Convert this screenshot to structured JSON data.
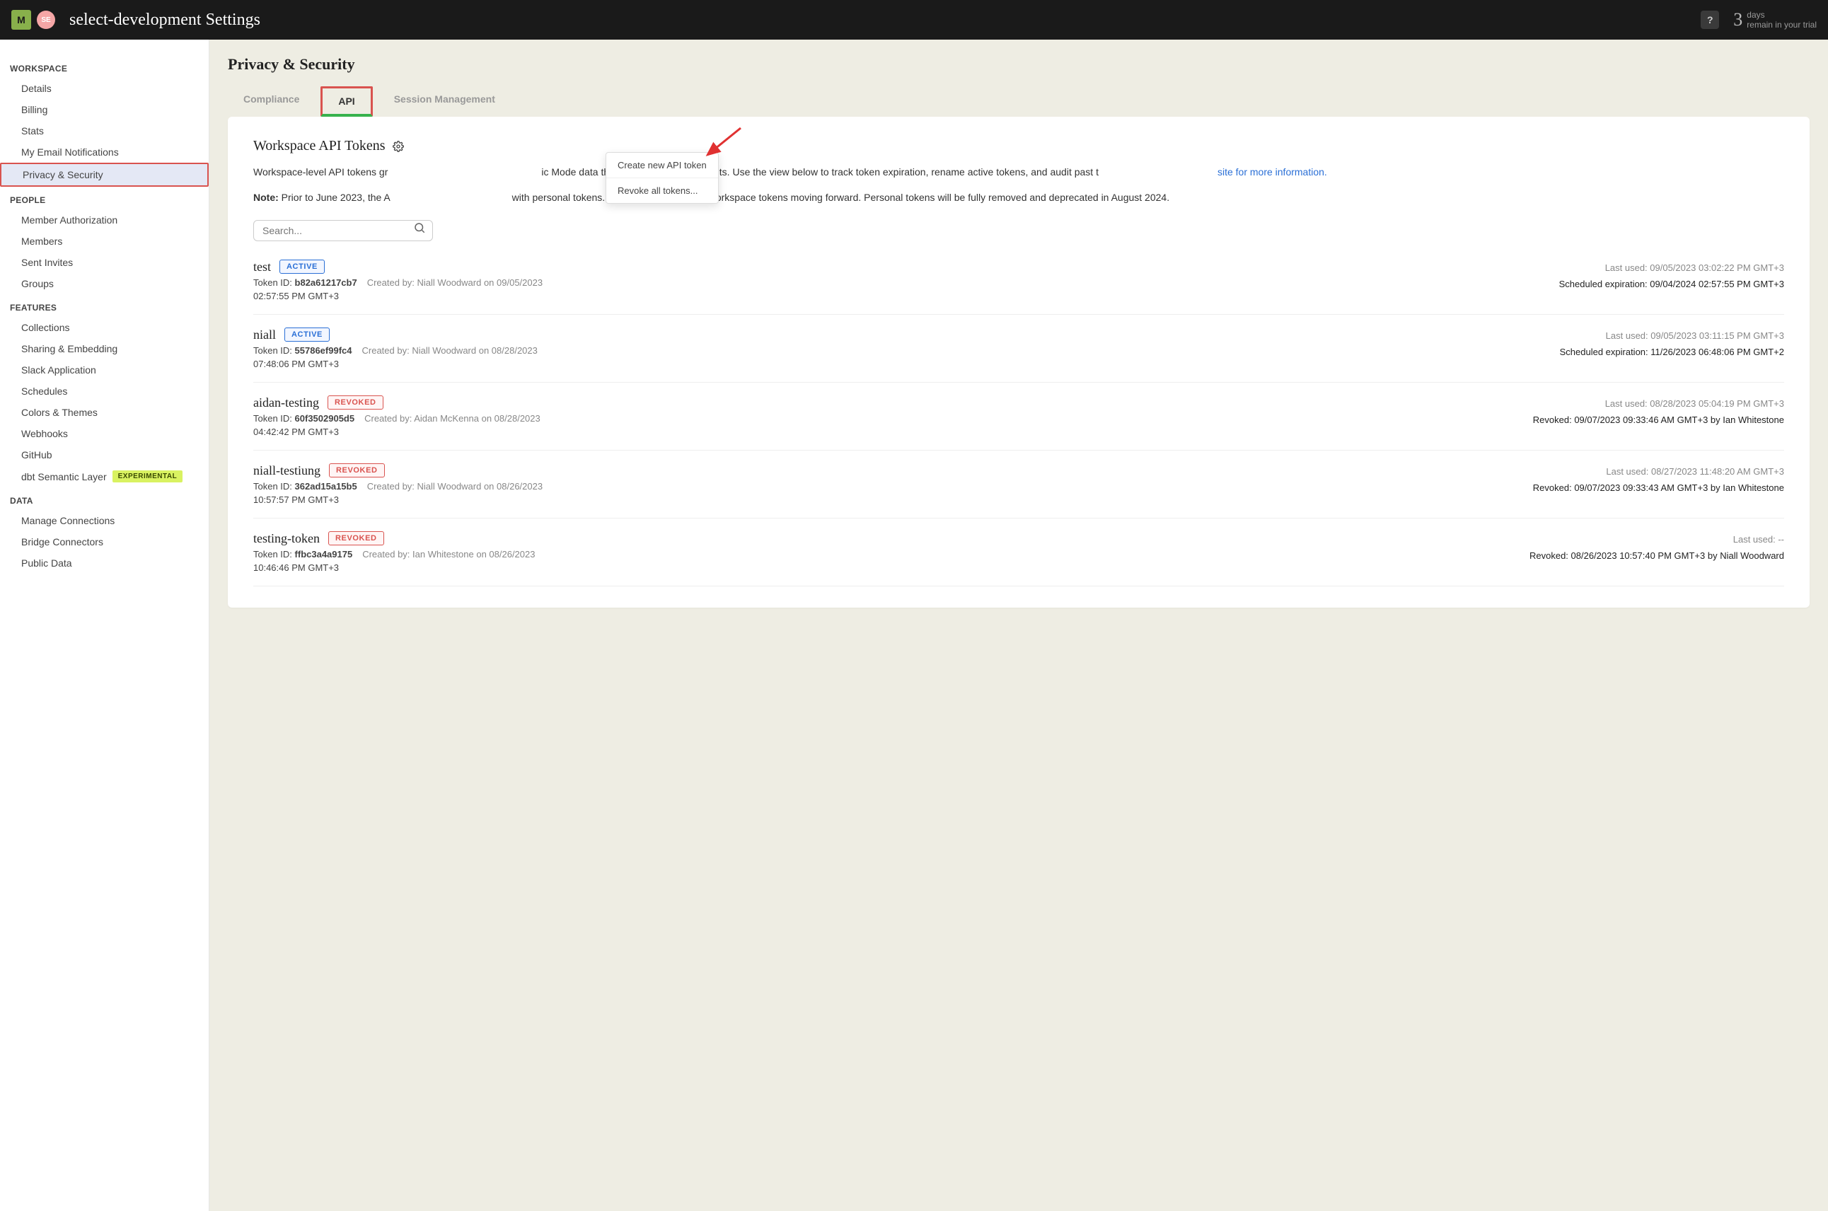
{
  "topbar": {
    "logo_text": "M",
    "avatar_text": "SE",
    "title": "select-development Settings",
    "help_icon": "?",
    "trial_num": "3",
    "trial_line1": "days",
    "trial_line2": "remain in your trial"
  },
  "sidebar": {
    "sections": [
      {
        "heading": "WORKSPACE",
        "items": [
          {
            "label": "Details"
          },
          {
            "label": "Billing"
          },
          {
            "label": "Stats"
          },
          {
            "label": "My Email Notifications"
          },
          {
            "label": "Privacy & Security",
            "active": true
          }
        ]
      },
      {
        "heading": "PEOPLE",
        "items": [
          {
            "label": "Member Authorization"
          },
          {
            "label": "Members"
          },
          {
            "label": "Sent Invites"
          },
          {
            "label": "Groups"
          }
        ]
      },
      {
        "heading": "FEATURES",
        "items": [
          {
            "label": "Collections"
          },
          {
            "label": "Sharing & Embedding"
          },
          {
            "label": "Slack Application"
          },
          {
            "label": "Schedules"
          },
          {
            "label": "Colors & Themes"
          },
          {
            "label": "Webhooks"
          },
          {
            "label": "GitHub"
          },
          {
            "label": "dbt Semantic Layer",
            "badge": "EXPERIMENTAL"
          }
        ]
      },
      {
        "heading": "DATA",
        "items": [
          {
            "label": "Manage Connections"
          },
          {
            "label": "Bridge Connectors"
          },
          {
            "label": "Public Data"
          }
        ]
      }
    ]
  },
  "main": {
    "heading": "Privacy & Security",
    "tabs": [
      {
        "label": "Compliance"
      },
      {
        "label": "API",
        "active": true
      },
      {
        "label": "Session Management"
      }
    ],
    "section_title": "Workspace API Tokens",
    "desc_part1": "Workspace-level API tokens gr",
    "desc_part2": "ic Mode data through public API endpoints. Use the view below to track token expiration, rename active tokens, and audit past t",
    "desc_link": "site for more information.",
    "note_label": "Note:",
    "note_text": " Prior to June 2023, the A",
    "note_tail": " with personal tokens. We recommend using Workspace tokens moving forward. Personal tokens will be fully removed and deprecated in August 2024.",
    "dropdown": {
      "create": "Create new API token",
      "revoke": "Revoke all tokens..."
    },
    "search_placeholder": "Search...",
    "tokens": [
      {
        "name": "test",
        "status": "ACTIVE",
        "token_id_label": "Token ID:",
        "token_id": "b82a61217cb7",
        "created_label": "Created by:",
        "created": "Niall Woodward on 09/05/2023",
        "time": "02:57:55 PM GMT+3",
        "last_used_label": "Last used:",
        "last_used": "09/05/2023 03:02:22 PM GMT+3",
        "extra_label": "Scheduled expiration:",
        "extra": "09/04/2024 02:57:55 PM GMT+3"
      },
      {
        "name": "niall",
        "status": "ACTIVE",
        "token_id_label": "Token ID:",
        "token_id": "55786ef99fc4",
        "created_label": "Created by:",
        "created": "Niall Woodward on 08/28/2023",
        "time": "07:48:06 PM GMT+3",
        "last_used_label": "Last used:",
        "last_used": "09/05/2023 03:11:15 PM GMT+3",
        "extra_label": "Scheduled expiration:",
        "extra": "11/26/2023 06:48:06 PM GMT+2"
      },
      {
        "name": "aidan-testing",
        "status": "REVOKED",
        "token_id_label": "Token ID:",
        "token_id": "60f3502905d5",
        "created_label": "Created by:",
        "created": "Aidan McKenna on 08/28/2023",
        "time": "04:42:42 PM GMT+3",
        "last_used_label": "Last used:",
        "last_used": "08/28/2023 05:04:19 PM GMT+3",
        "extra_label": "Revoked:",
        "extra": "09/07/2023 09:33:46 AM GMT+3 by Ian Whitestone"
      },
      {
        "name": "niall-testiung",
        "status": "REVOKED",
        "token_id_label": "Token ID:",
        "token_id": "362ad15a15b5",
        "created_label": "Created by:",
        "created": "Niall Woodward on 08/26/2023",
        "time": "10:57:57 PM GMT+3",
        "last_used_label": "Last used:",
        "last_used": "08/27/2023 11:48:20 AM GMT+3",
        "extra_label": "Revoked:",
        "extra": "09/07/2023 09:33:43 AM GMT+3 by Ian Whitestone"
      },
      {
        "name": "testing-token",
        "status": "REVOKED",
        "token_id_label": "Token ID:",
        "token_id": "ffbc3a4a9175",
        "created_label": "Created by:",
        "created": "Ian Whitestone on 08/26/2023",
        "time": "10:46:46 PM GMT+3",
        "last_used_label": "Last used:",
        "last_used": "--",
        "extra_label": "Revoked:",
        "extra": "08/26/2023 10:57:40 PM GMT+3 by Niall Woodward"
      }
    ]
  }
}
